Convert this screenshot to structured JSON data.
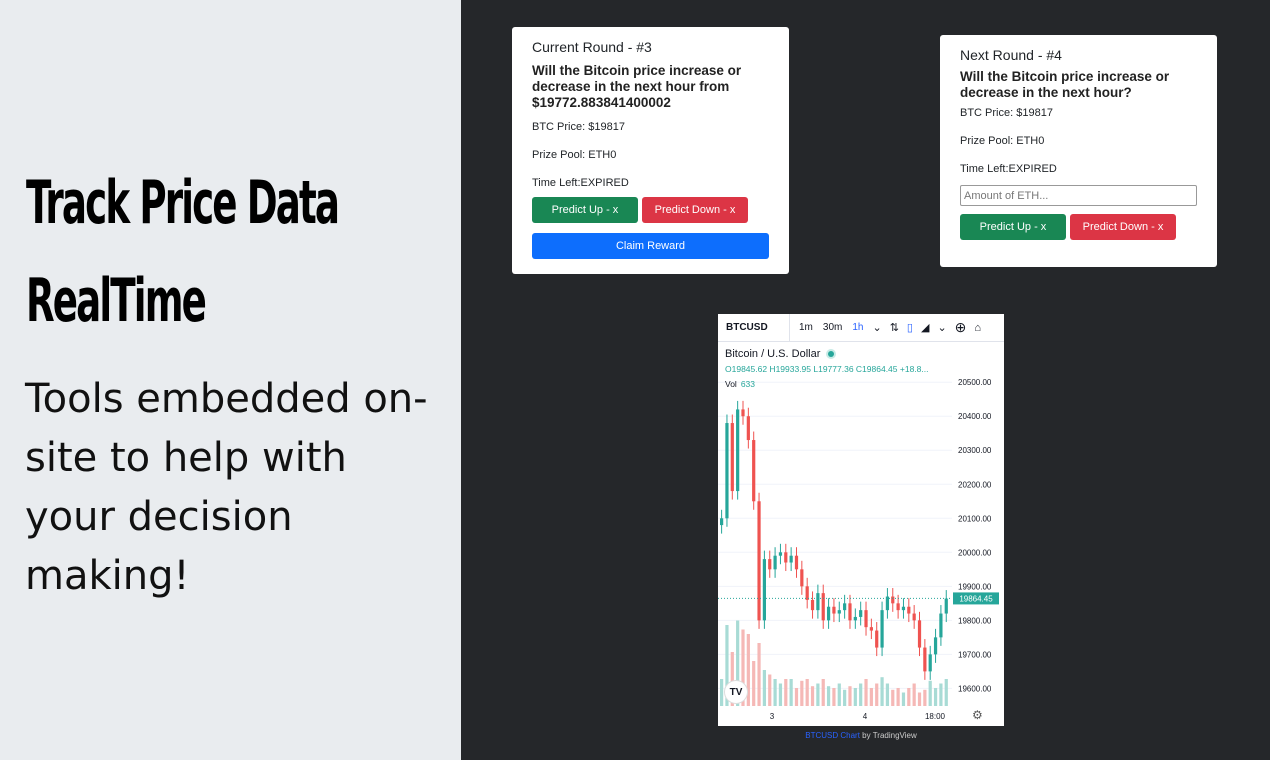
{
  "promo": {
    "headline_line1": "Track Price Data",
    "headline_line2": "RealTime",
    "tagline": "Tools embedded on-site to help with your decision making!"
  },
  "current_round": {
    "title": "Current Round - #3",
    "question": "Will the Bitcoin price increase or decrease in the next hour from $19772.883841400002",
    "btc_price": "BTC Price: $19817",
    "prize_pool": "Prize Pool: ETH0",
    "time_left": "Time Left:EXPIRED",
    "predict_up_label": "Predict Up - x",
    "predict_down_label": "Predict Down - x",
    "claim_label": "Claim Reward"
  },
  "next_round": {
    "title": "Next Round - #4",
    "question": "Will the Bitcoin price increase or decrease in the next hour?",
    "btc_price": "BTC Price: $19817",
    "prize_pool": "Prize Pool: ETH0",
    "time_left": "Time Left:EXPIRED",
    "amount_placeholder": "Amount of ETH...",
    "predict_up_label": "Predict Up - x",
    "predict_down_label": "Predict Down - x"
  },
  "chart_widget": {
    "symbol": "BTCUSD",
    "intervals": [
      "1m",
      "30m",
      "1h"
    ],
    "active_interval": "1h",
    "instrument_name": "Bitcoin / U.S. Dollar",
    "ohlc": "O19845.62 H19933.95 L19777.36 C19864.45 +18.8...",
    "vol_label": "Vol",
    "vol_value": "633",
    "logo_text": "TV",
    "attribution_link": "BTCUSD Chart",
    "attribution_by": " by TradingView",
    "up_color": "#26a69a",
    "down_color": "#ef5350"
  },
  "chart_data": {
    "type": "candlestick",
    "symbol": "BTCUSD",
    "y_ticks": [
      20500,
      20400,
      20300,
      20200,
      20100,
      20000,
      19900,
      19800,
      19700,
      19600
    ],
    "ylim": [
      19560,
      20530
    ],
    "last_price": 19864.45,
    "last_price_label": "19864.45",
    "x_ticks": [
      "3",
      "4",
      "18:00"
    ],
    "closes": [
      20100,
      20380,
      20180,
      20420,
      20400,
      20330,
      20150,
      19800,
      19980,
      19950,
      19990,
      20000,
      19970,
      19990,
      19950,
      19900,
      19860,
      19830,
      19880,
      19800,
      19840,
      19820,
      19830,
      19850,
      19800,
      19810,
      19830,
      19780,
      19770,
      19720,
      19830,
      19870,
      19850,
      19830,
      19840,
      19820,
      19800,
      19720,
      19650,
      19700,
      19750,
      19820,
      19864
    ],
    "volumes": [
      0.3,
      0.9,
      0.6,
      0.95,
      0.85,
      0.8,
      0.5,
      0.7,
      0.4,
      0.35,
      0.3,
      0.25,
      0.3,
      0.3,
      0.2,
      0.28,
      0.3,
      0.22,
      0.25,
      0.3,
      0.22,
      0.2,
      0.25,
      0.18,
      0.22,
      0.2,
      0.25,
      0.3,
      0.2,
      0.25,
      0.32,
      0.25,
      0.18,
      0.2,
      0.15,
      0.2,
      0.25,
      0.15,
      0.18,
      0.28,
      0.2,
      0.25,
      0.3
    ]
  }
}
